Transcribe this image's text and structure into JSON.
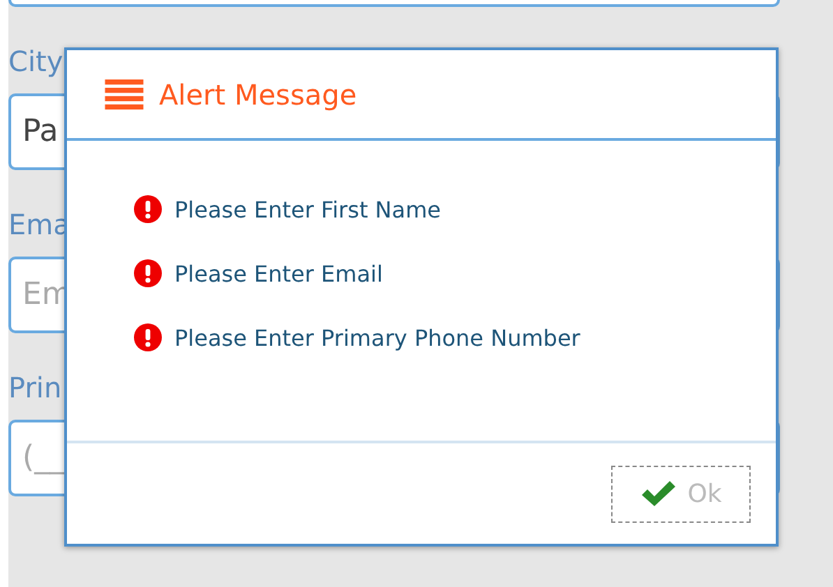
{
  "form": {
    "fields": [
      {
        "label": "City",
        "value": "Pa"
      },
      {
        "label": "Ema",
        "placeholder": "Em"
      },
      {
        "label": "Prin",
        "placeholder": "(__"
      }
    ]
  },
  "dialog": {
    "title": "Alert Message",
    "messages": [
      "Please Enter First Name",
      "Please Enter Email",
      "Please Enter Primary Phone Number"
    ],
    "button": "Ok"
  }
}
